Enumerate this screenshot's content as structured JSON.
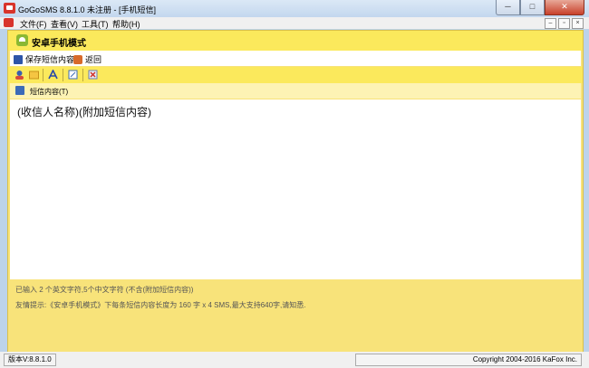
{
  "window": {
    "title": "GoGoSMS 8.8.1.0  未注册 - [手机短信]",
    "controls": [
      "─",
      "□",
      "✕"
    ]
  },
  "menubar": {
    "items": [
      "文件(F)",
      "查看(V)",
      "工具(T)",
      "帮助(H)"
    ],
    "mdi_controls": [
      "–",
      "▫",
      "×"
    ]
  },
  "panel": {
    "mode_title": "安卓手机模式",
    "toolbar": {
      "save_label": "保存短信内容",
      "back_label": "返回"
    },
    "format_toolbar_icons": [
      "address-book-icon",
      "folder-icon",
      "font-icon",
      "edit-icon",
      "delete-icon"
    ],
    "tab": {
      "label": "短信内容(T)"
    },
    "editor": {
      "value": "(收信人名称)(附加短信内容)"
    },
    "char_count": "已输入 2 个英文字符,5个中文字符 (不含(附加短信内容))",
    "hint": "友情提示:《安卓手机模式》下每条短信内容长度为 160 字 x 4 SMS,最大支持640字,请知悉."
  },
  "status": {
    "version": "版本V:8.8.1.0",
    "copyright": "Copyright 2004-2016 KaFox Inc."
  },
  "colors": {
    "panel_bg": "#f8e37a",
    "header_bg": "#fbe95c",
    "titlebar": "#c3d7ee"
  }
}
